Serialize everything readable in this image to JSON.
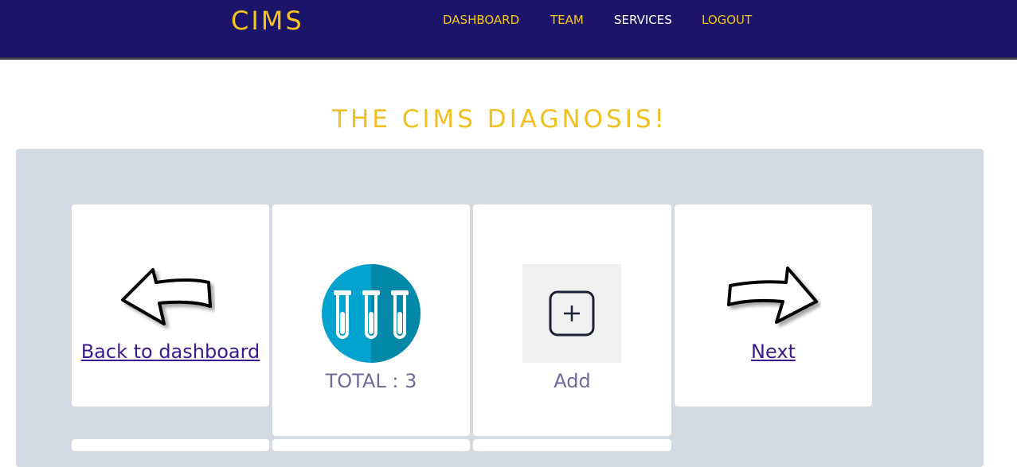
{
  "nav": {
    "brand": "CIMS",
    "links": [
      {
        "label": "DASHBOARD",
        "color": "#f5c518"
      },
      {
        "label": "TEAM",
        "color": "#f5c518"
      },
      {
        "label": "SERVICES",
        "color": "#ffffff"
      },
      {
        "label": "LOGOUT",
        "color": "#f5c518"
      }
    ]
  },
  "page": {
    "heading": "THE CIMS DIAGNOSIS!"
  },
  "cards": {
    "back": {
      "label": "Back to dashboard",
      "icon": "arrow-left-icon"
    },
    "total": {
      "label": "TOTAL : 3",
      "icon": "test-tubes-icon"
    },
    "add": {
      "label": "Add",
      "icon": "plus-square-icon"
    },
    "next": {
      "label": "Next",
      "icon": "arrow-right-icon"
    }
  },
  "colors": {
    "navbar": "#1c1468",
    "accent": "#f5c518",
    "panel": "#d3dae1",
    "link": "#3b1b8c",
    "caption": "#6f6a9a",
    "icon_circle": "#03a3d0"
  }
}
